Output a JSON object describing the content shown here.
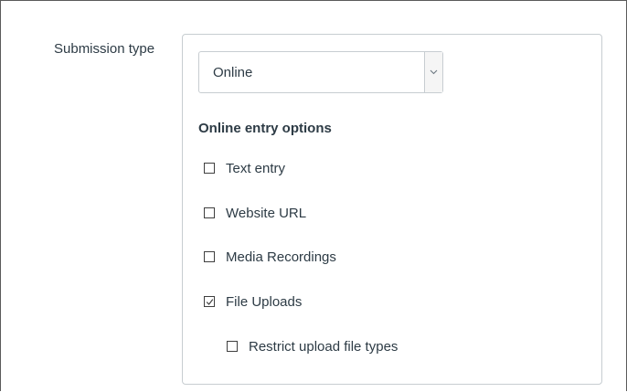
{
  "submission": {
    "label": "Submission type",
    "select": {
      "value": "Online"
    },
    "options_title": "Online entry options",
    "options": [
      {
        "label": "Text entry",
        "checked": false
      },
      {
        "label": "Website URL",
        "checked": false
      },
      {
        "label": "Media Recordings",
        "checked": false
      },
      {
        "label": "File Uploads",
        "checked": true
      },
      {
        "label": "Restrict upload file types",
        "checked": false
      }
    ]
  },
  "colors": {
    "text": "#2d3b45",
    "border": "#c7cdd1",
    "checkbox_border": "#3f3f3f"
  }
}
